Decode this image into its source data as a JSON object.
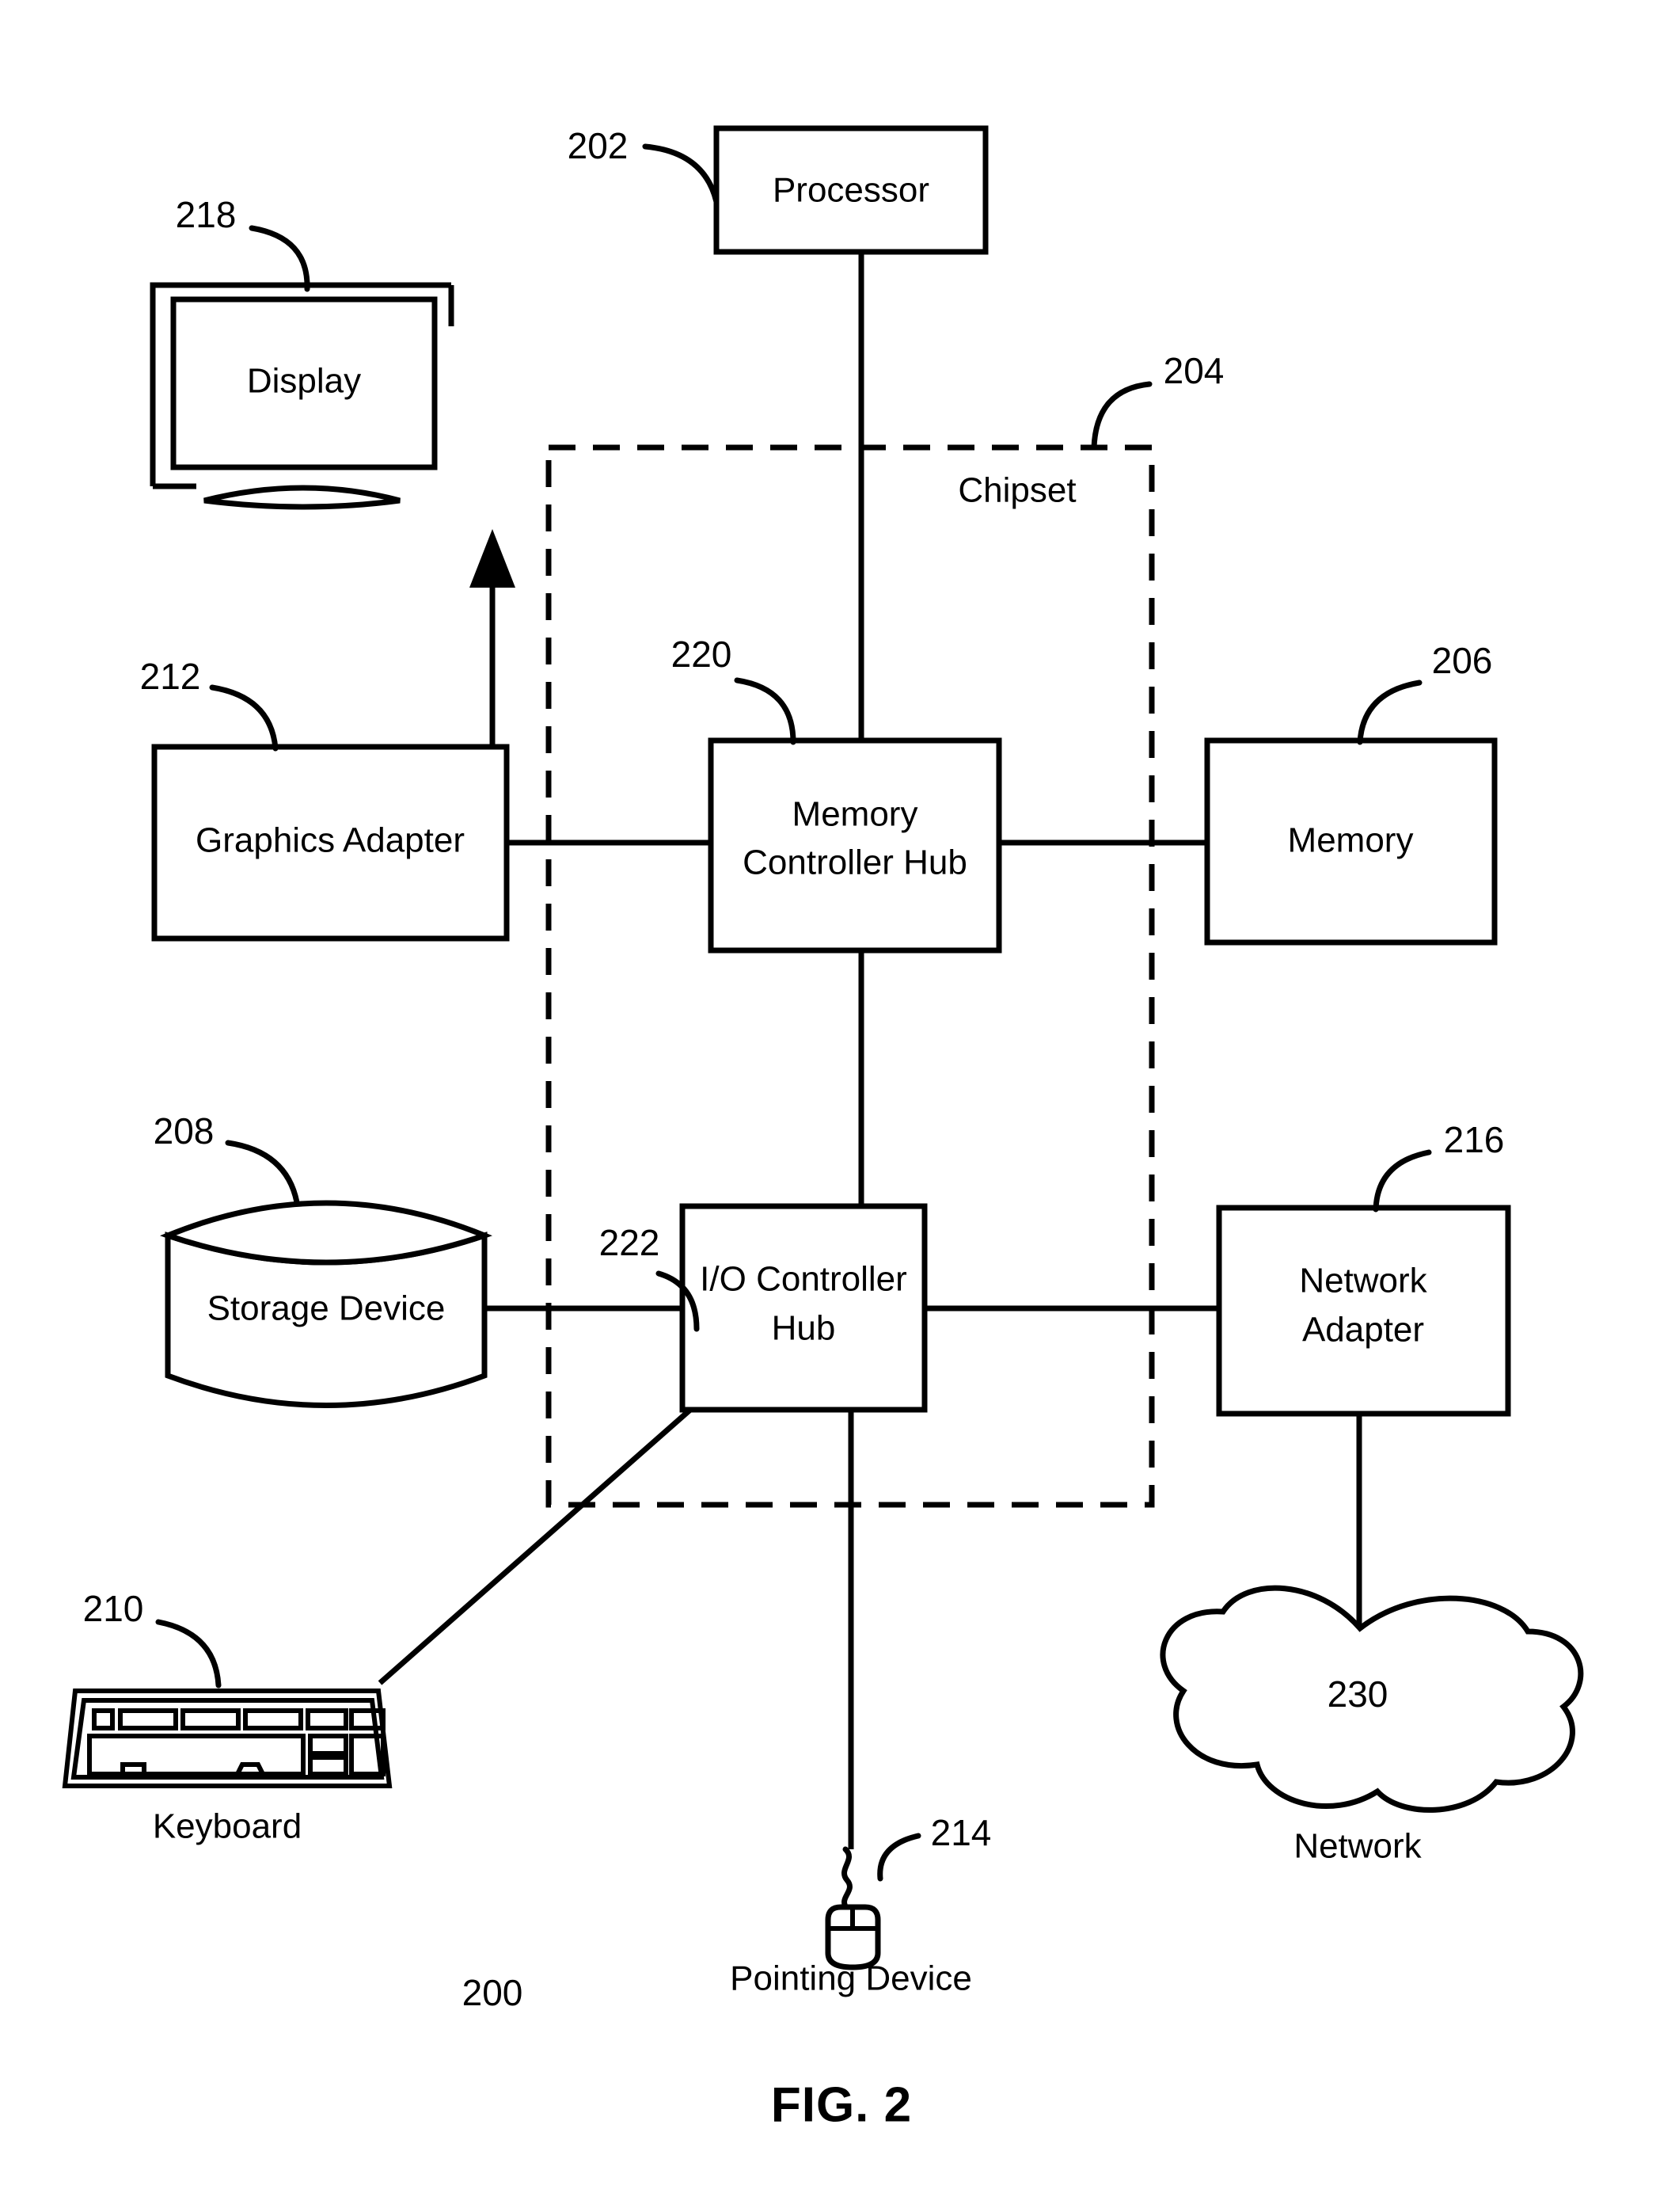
{
  "figure": {
    "caption": "FIG. 2",
    "system_ref": "200"
  },
  "blocks": [
    {
      "id": "processor",
      "label": "Processor",
      "ref": "202"
    },
    {
      "id": "chipset",
      "label": "Chipset",
      "ref": "204"
    },
    {
      "id": "memory",
      "label": "Memory",
      "ref": "206"
    },
    {
      "id": "storage_device",
      "label": "Storage Device",
      "ref": "208"
    },
    {
      "id": "keyboard",
      "label": "Keyboard",
      "ref": "210"
    },
    {
      "id": "graphics_adapter",
      "label": "Graphics Adapter",
      "ref": "212"
    },
    {
      "id": "pointing_device",
      "label": "Pointing Device",
      "ref": "214"
    },
    {
      "id": "network_adapter",
      "label": "Network",
      "label2": "Adapter",
      "ref": "216"
    },
    {
      "id": "display",
      "label": "Display",
      "ref": "218"
    },
    {
      "id": "mch",
      "label": "Memory",
      "label2": "Controller Hub",
      "ref": "220"
    },
    {
      "id": "ich",
      "label": "I/O Controller",
      "label2": "Hub",
      "ref": "222"
    },
    {
      "id": "network",
      "label": "Network",
      "ref": "230"
    }
  ],
  "text": {
    "processor": "Processor",
    "chipset": "Chipset",
    "memory": "Memory",
    "storage_device": "Storage Device",
    "keyboard": "Keyboard",
    "graphics_adapter": "Graphics Adapter",
    "pointing_device": "Pointing Device",
    "network_adapter_line1": "Network",
    "network_adapter_line2": "Adapter",
    "display": "Display",
    "mch_line1": "Memory",
    "mch_line2": "Controller Hub",
    "ich_line1": "I/O Controller",
    "ich_line2": "Hub",
    "network": "Network"
  },
  "refs": {
    "processor": "202",
    "chipset": "204",
    "memory": "206",
    "storage_device": "208",
    "keyboard": "210",
    "graphics_adapter": "212",
    "pointing_device": "214",
    "network_adapter": "216",
    "display": "218",
    "mch": "220",
    "ich": "222",
    "network_cloud": "230",
    "system": "200"
  },
  "colors": {
    "ink": "#000000",
    "paper": "#ffffff"
  }
}
